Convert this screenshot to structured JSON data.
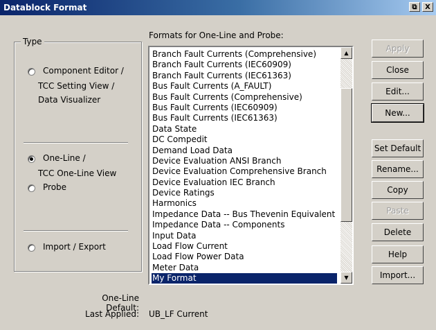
{
  "window": {
    "title": "Datablock Format",
    "restore_glyph": "⧉",
    "close_glyph": "X"
  },
  "type_group": {
    "title": "Type",
    "option1": {
      "line1": "Component Editor /",
      "line2": "TCC Setting View /",
      "line3": "Data Visualizer",
      "selected": false
    },
    "option2": {
      "line1": "One-Line /",
      "line2": "TCC One-Line View",
      "selected": true
    },
    "option3": {
      "label": "Probe",
      "selected": false
    },
    "option4": {
      "label": "Import / Export",
      "selected": false
    }
  },
  "list": {
    "label": "Formats for One-Line and Probe:",
    "items": [
      "Branch Fault Currents (Comprehensive)",
      "Branch Fault Currents (IEC60909)",
      "Branch Fault Currents (IEC61363)",
      "Bus Fault Currents (A_FAULT)",
      "Bus Fault Currents (Comprehensive)",
      "Bus Fault Currents (IEC60909)",
      "Bus Fault Currents (IEC61363)",
      "Data State",
      "DC Compedit",
      "Demand Load Data",
      "Device Evaluation ANSI Branch",
      "Device Evaluation Comprehensive Branch",
      "Device Evaluation IEC Branch",
      "Device Ratings",
      "Harmonics",
      "Impedance Data -- Bus Thevenin Equivalent",
      "Impedance Data -- Components",
      "Input Data",
      "Load Flow Current",
      "Load Flow Power Data",
      "Meter Data",
      "My Format"
    ],
    "selected": "My Format"
  },
  "buttons": {
    "apply": "Apply",
    "close": "Close",
    "edit": "Edit...",
    "new": "New...",
    "set_default": "Set Default",
    "rename": "Rename...",
    "copy": "Copy",
    "paste": "Paste",
    "delete": "Delete",
    "help": "Help",
    "import": "Import..."
  },
  "footer": {
    "default_label": "One-Line Default:",
    "default_value": "",
    "last_label": "Last Applied:",
    "last_value": "UB_LF Current"
  }
}
